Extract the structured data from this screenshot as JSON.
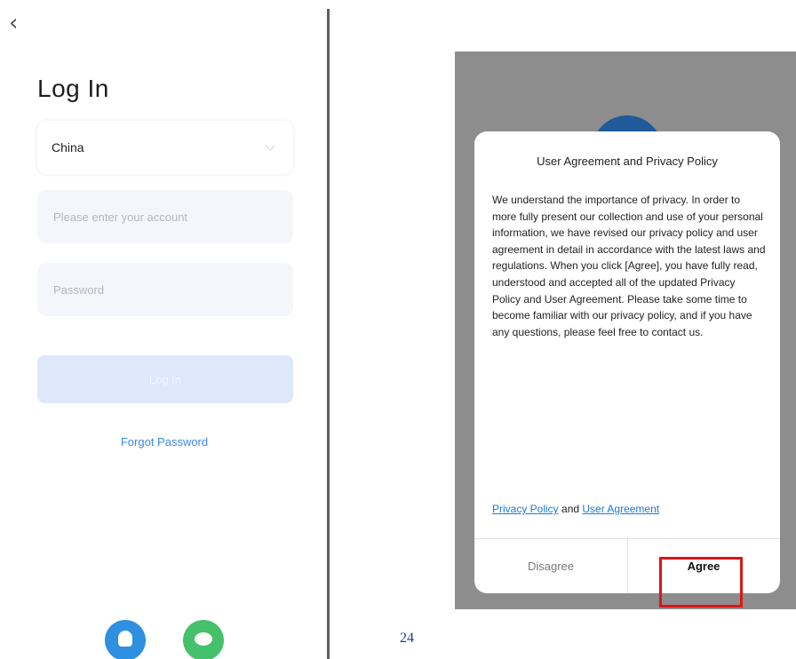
{
  "login": {
    "back_icon": "chevron-left-icon",
    "title": "Log In",
    "country_value": "China",
    "account_placeholder": "Please enter your account",
    "password_placeholder": "Password",
    "login_button_label": "Log In",
    "forgot_password_label": "Forgot Password",
    "social_icons": [
      "alexa-icon",
      "wechat-icon"
    ],
    "colors": {
      "login_button_bg": "#dde8fb",
      "link": "#3a8ae8"
    }
  },
  "page_number": "24",
  "dialog": {
    "title": "User Agreement and Privacy Policy",
    "body": "We understand the importance of privacy. In order to more fully present our collection and use of your personal information, we have revised our privacy policy and user agreement in detail in accordance with the latest laws and regulations. When you click [Agree], you have fully read, understood and accepted all of the updated Privacy Policy and User Agreement. Please take some time to become familiar with our privacy policy, and if you have any questions, please feel free to contact us.",
    "privacy_link": "Privacy Policy",
    "and_text": " and ",
    "agreement_link": "User Agreement",
    "disagree_label": "Disagree",
    "agree_label": "Agree",
    "colors": {
      "overlay": "#8d8d8d",
      "highlight": "#e01515"
    }
  }
}
